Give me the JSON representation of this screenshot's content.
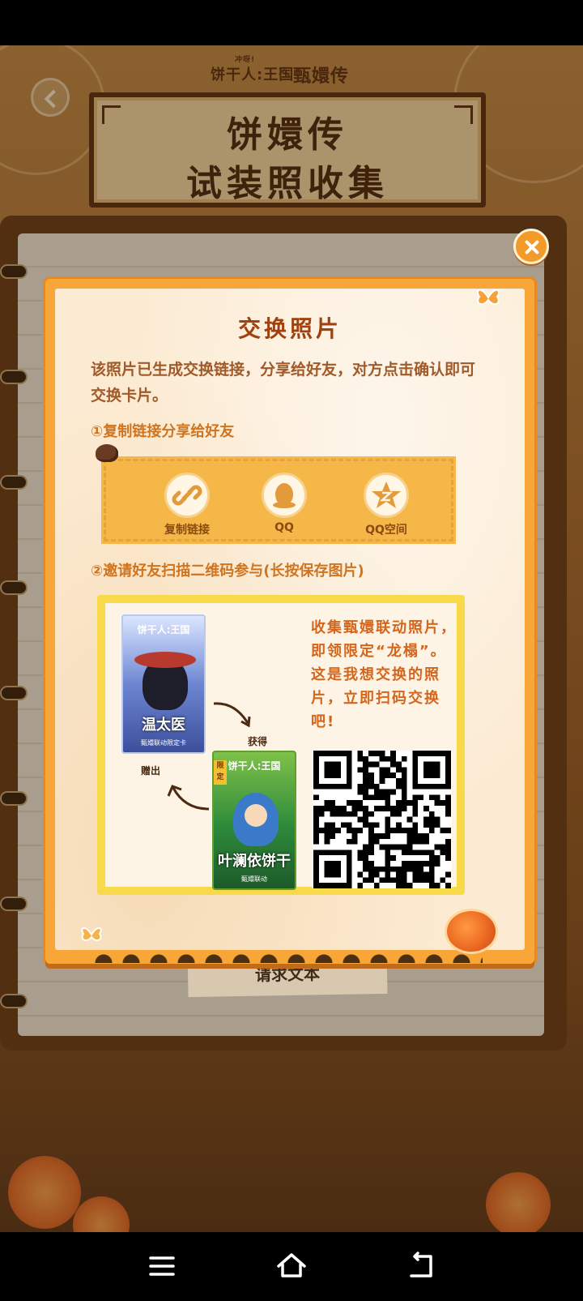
{
  "header": {
    "logo_small": "冲呀!",
    "logo_left": "饼干人:王国",
    "logo_cross": "×",
    "logo_right": "甄嬛传"
  },
  "title_board": {
    "line1": "饼嬛传",
    "line2": "试装照收集"
  },
  "background": {
    "button_label": "请求文本"
  },
  "modal": {
    "title": "交换照片",
    "description": "该照片已生成交换链接，分享给好友，对方点击确认即可交换卡片。",
    "step1_label": "①复制链接分享给好友",
    "step2_label": "②邀请好友扫描二维码参与(长按保存图片)",
    "share_options": [
      {
        "label": "复制链接",
        "icon": "link-icon"
      },
      {
        "label": "QQ",
        "icon": "qq-penguin-icon"
      },
      {
        "label": "QQ空间",
        "icon": "qzone-star-icon"
      }
    ],
    "invite": {
      "text": "收集甄嬛联动照片，即领限定“龙榻”。这是我想交换的照片，立即扫码交换吧!",
      "card1": {
        "top": "饼干人:王国",
        "name": "温太医",
        "sub": "甄嬛联动限定卡"
      },
      "card2": {
        "tag": "限定",
        "top": "饼干人:王国",
        "name": "叶澜依饼干",
        "sub": "甄嬛联动"
      },
      "label_get": "获得",
      "label_give": "赠出"
    }
  },
  "colors": {
    "modal_orange": "#f7a637",
    "title_brown": "#a04210",
    "accent_orange": "#d07420"
  }
}
